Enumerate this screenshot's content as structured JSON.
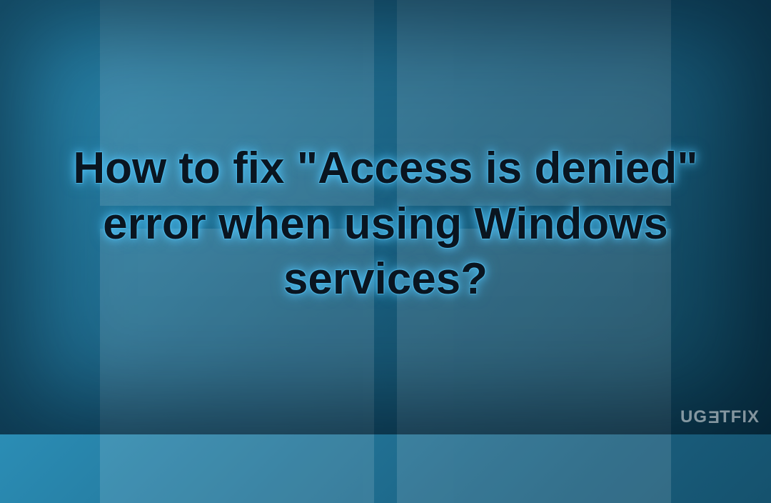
{
  "headline": "How to fix \"Access is denied\" error when using Windows services?",
  "watermark": {
    "part1": "UG",
    "part2": "E",
    "part3": "TFIX"
  },
  "colors": {
    "text": "#0a1520",
    "glow": "#50c8ff"
  }
}
